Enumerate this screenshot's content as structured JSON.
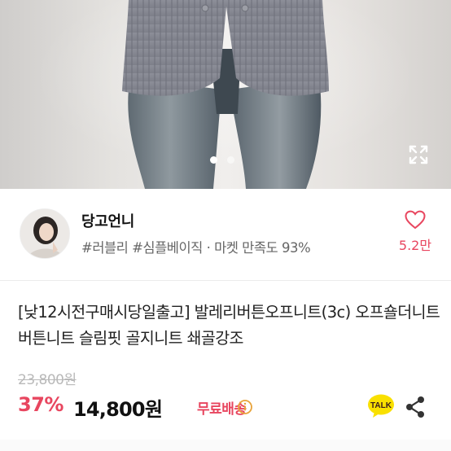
{
  "gallery": {
    "image_alt": "",
    "slide_count": 3,
    "active_slide": 1,
    "expand_icon": "expand-icon"
  },
  "seller": {
    "name": "당고언니",
    "tags": "#러블리 #심플베이직 · 마켓 만족도 93%",
    "like_icon": "heart-outline-icon",
    "like_count": "5.2만"
  },
  "product": {
    "title": "[낮12시전구매시당일출고] 발레리버튼오프니트(3c) 오프숄더니트 버튼니트 슬림핏 골지니트 쇄골강조",
    "original_price": "23,800원",
    "discount_rate": "37%",
    "sale_price": "14,800원",
    "shipping_label": "무료배송",
    "shipping_info_icon": "info-circle-icon"
  },
  "actions": {
    "talk_label": "TALK",
    "share_icon": "share-icon"
  },
  "colors": {
    "accent": "#e8465f",
    "talk_yellow": "#f9e000",
    "text": "#222222",
    "muted": "#666666"
  }
}
